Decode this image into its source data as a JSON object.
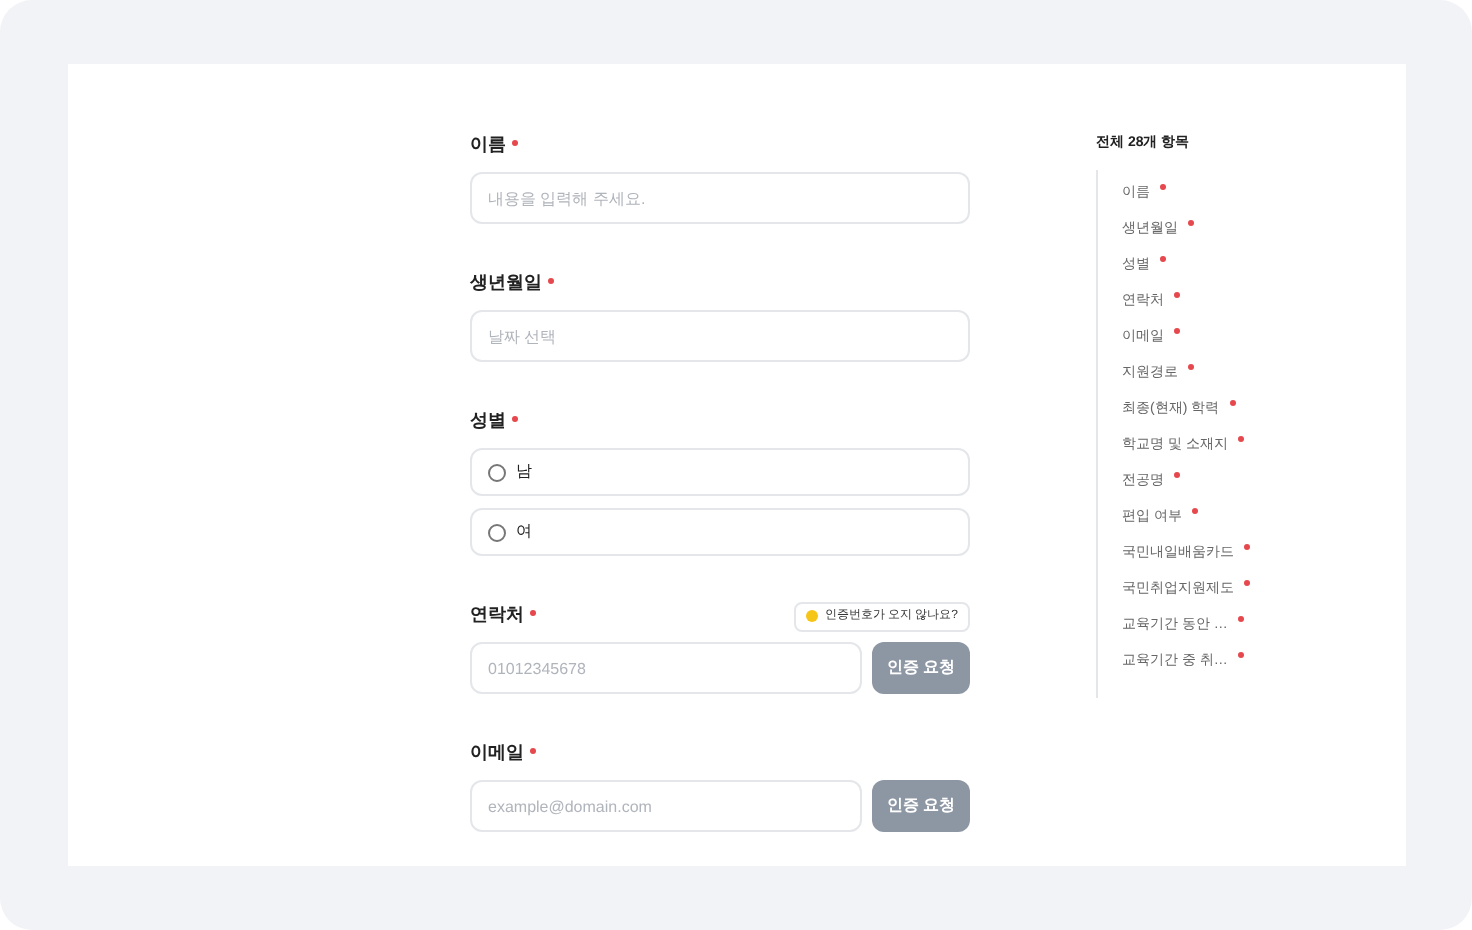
{
  "form": {
    "fields": [
      {
        "kind": "text",
        "label": "이름",
        "required": true,
        "placeholder": "내용을 입력해 주세요."
      },
      {
        "kind": "date",
        "label": "생년월일",
        "required": true,
        "placeholder": "날짜 선택"
      },
      {
        "kind": "radio",
        "label": "성별",
        "required": true,
        "options": [
          {
            "label": "남",
            "selected": false
          },
          {
            "label": "여",
            "selected": false
          }
        ]
      },
      {
        "kind": "verify",
        "label": "연락처",
        "required": true,
        "help": "인증번호가 오지 않나요?",
        "placeholder": "01012345678",
        "button": "인증 요청"
      },
      {
        "kind": "verify",
        "label": "이메일",
        "required": true,
        "placeholder": "example@domain.com",
        "button": "인증 요청"
      }
    ]
  },
  "outline": {
    "title": "전체 28개 항목",
    "items": [
      {
        "label": "이름",
        "required": true
      },
      {
        "label": "생년월일",
        "required": true
      },
      {
        "label": "성별",
        "required": true
      },
      {
        "label": "연락처",
        "required": true
      },
      {
        "label": "이메일",
        "required": true
      },
      {
        "label": "지원경로",
        "required": true
      },
      {
        "label": "최종(현재) 학력",
        "required": true
      },
      {
        "label": "학교명 및 소재지",
        "required": true
      },
      {
        "label": "전공명",
        "required": true
      },
      {
        "label": "편입 여부",
        "required": true
      },
      {
        "label": "국민내일배움카드",
        "required": true
      },
      {
        "label": "국민취업지원제도",
        "required": true
      },
      {
        "label": "교육기간 동안 …",
        "required": true
      },
      {
        "label": "교육기간 중 취…",
        "required": true
      }
    ]
  }
}
